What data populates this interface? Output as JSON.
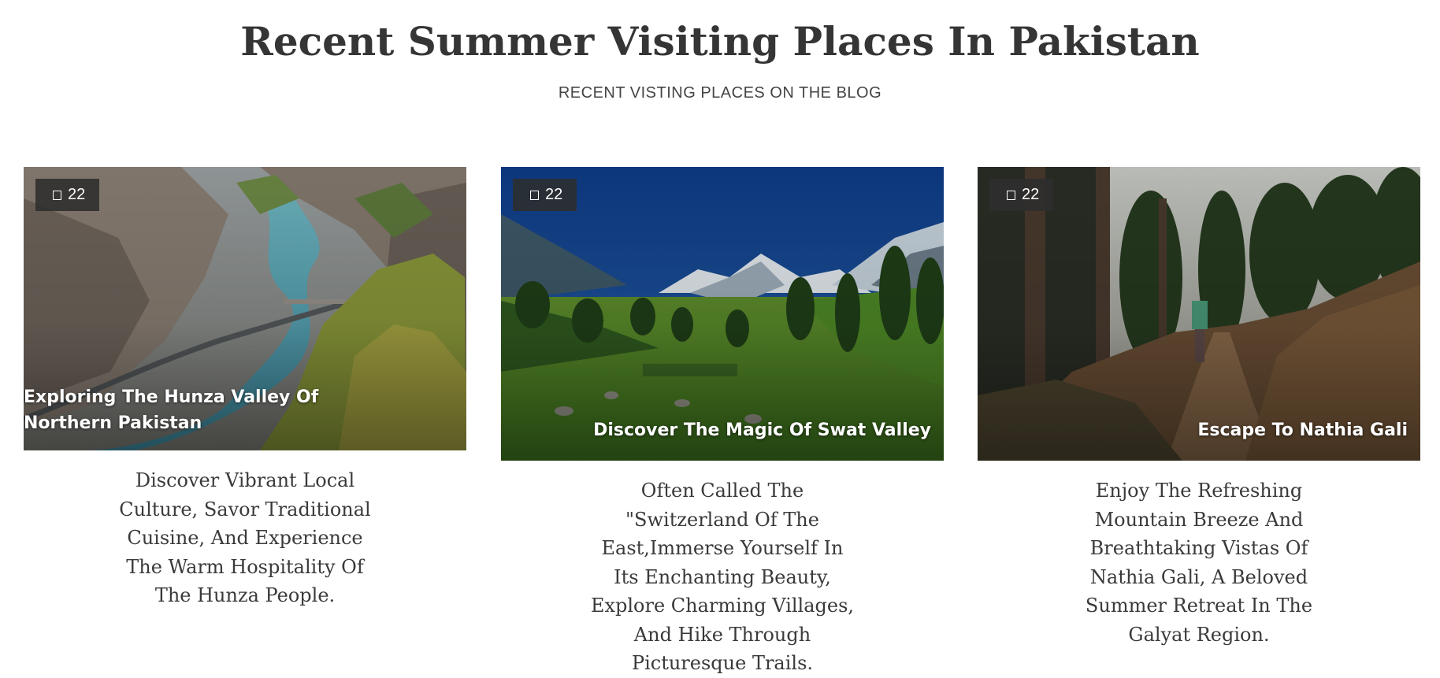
{
  "header": {
    "title": "Recent Summer Visiting Places In Pakistan",
    "subtitle": "RECENT VISTING PLACES ON THE BLOG"
  },
  "cards": [
    {
      "comment_count": "22",
      "title": "Exploring The Hunza Valley Of Northern Pakistan",
      "excerpt": "Discover Vibrant Local Culture, Savor Traditional Cuisine, And Experience The Warm Hospitality Of The Hunza People."
    },
    {
      "comment_count": "22",
      "title": "Discover The Magic Of Swat Valley",
      "excerpt": "Often Called The \"Switzerland Of The East,Immerse Yourself In Its Enchanting Beauty, Explore Charming Villages, And Hike Through Picturesque Trails."
    },
    {
      "comment_count": "22",
      "title": "Escape To Nathia Gali",
      "excerpt": "Enjoy The Refreshing Mountain Breeze And Breathtaking Vistas Of Nathia Gali, A Beloved Summer Retreat In The Galyat Region."
    }
  ],
  "icons": {
    "badge_icon": "comment-icon"
  },
  "colors": {
    "title_text": "#353535",
    "body_text": "#3a3a3a",
    "badge_bg": "#2d2d2d",
    "overlay_text": "#ffffff"
  }
}
